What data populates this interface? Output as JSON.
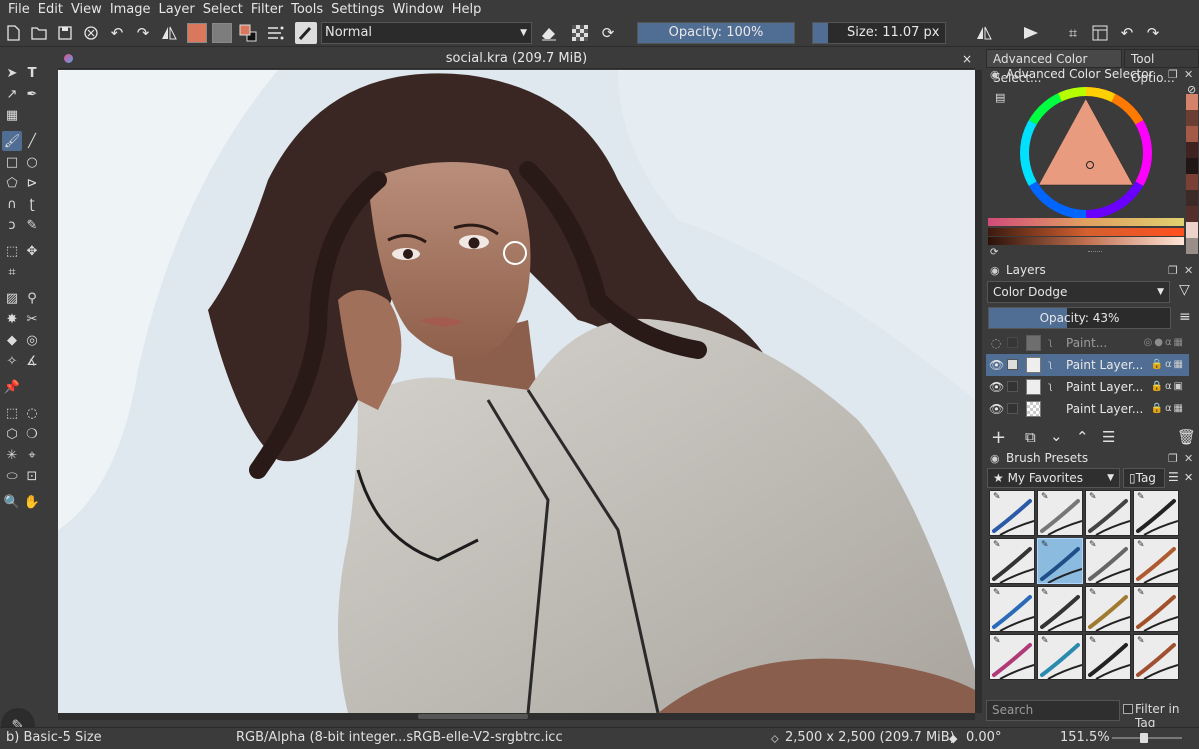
{
  "menubar": {
    "items": [
      "File",
      "Edit",
      "View",
      "Image",
      "Layer",
      "Select",
      "Filter",
      "Tools",
      "Settings",
      "Window",
      "Help"
    ]
  },
  "toolbar": {
    "blend_mode": "Normal",
    "opacity_label": "Opacity: 100%",
    "opacity_fraction": 1.0,
    "size_label": "Size: 11.07 px",
    "size_fraction": 0.11,
    "fg_color": "#d9785c",
    "bg_color": "#bdbdbd"
  },
  "document": {
    "title": "social.kra (209.7 MiB)",
    "close": "×"
  },
  "dock": {
    "tabs": [
      "Advanced Color Select...",
      "Tool Optio..."
    ],
    "color_panel_title": "Advanced Color Selector",
    "recent_colors": [
      "#d4826a",
      "#6b3e33",
      "#a35a47",
      "#3e2320",
      "#201616",
      "#7a4035",
      "#3c2a27",
      "#552f29",
      "#ecd2c8",
      "#9a8e88"
    ],
    "layers_title": "Layers",
    "layer_blend": "Color Dodge",
    "layer_opacity_label": "Opacity: 43%",
    "layer_opacity_fraction": 0.43,
    "layers": [
      {
        "name": "Paint...",
        "selected": false,
        "dim": true
      },
      {
        "name": "Paint Layer...",
        "selected": true,
        "dim": false
      },
      {
        "name": "Paint Layer...",
        "selected": false,
        "dim": false
      },
      {
        "name": "Paint Layer...",
        "selected": false,
        "dim": false
      }
    ],
    "brush_title": "Brush Presets",
    "brush_tag_combo": "My Favorites",
    "tag_button": "Tag",
    "search_placeholder": "Search",
    "filter_in_tag": "Filter in Tag"
  },
  "status": {
    "brush": "b) Basic-5 Size",
    "colorspace": "RGB/Alpha (8-bit integer...sRGB-elle-V2-srgbtrc.icc",
    "image_size": "2,500 x 2,500 (209.7 MiB)",
    "rotation": "0.00°",
    "zoom": "151.5%"
  }
}
